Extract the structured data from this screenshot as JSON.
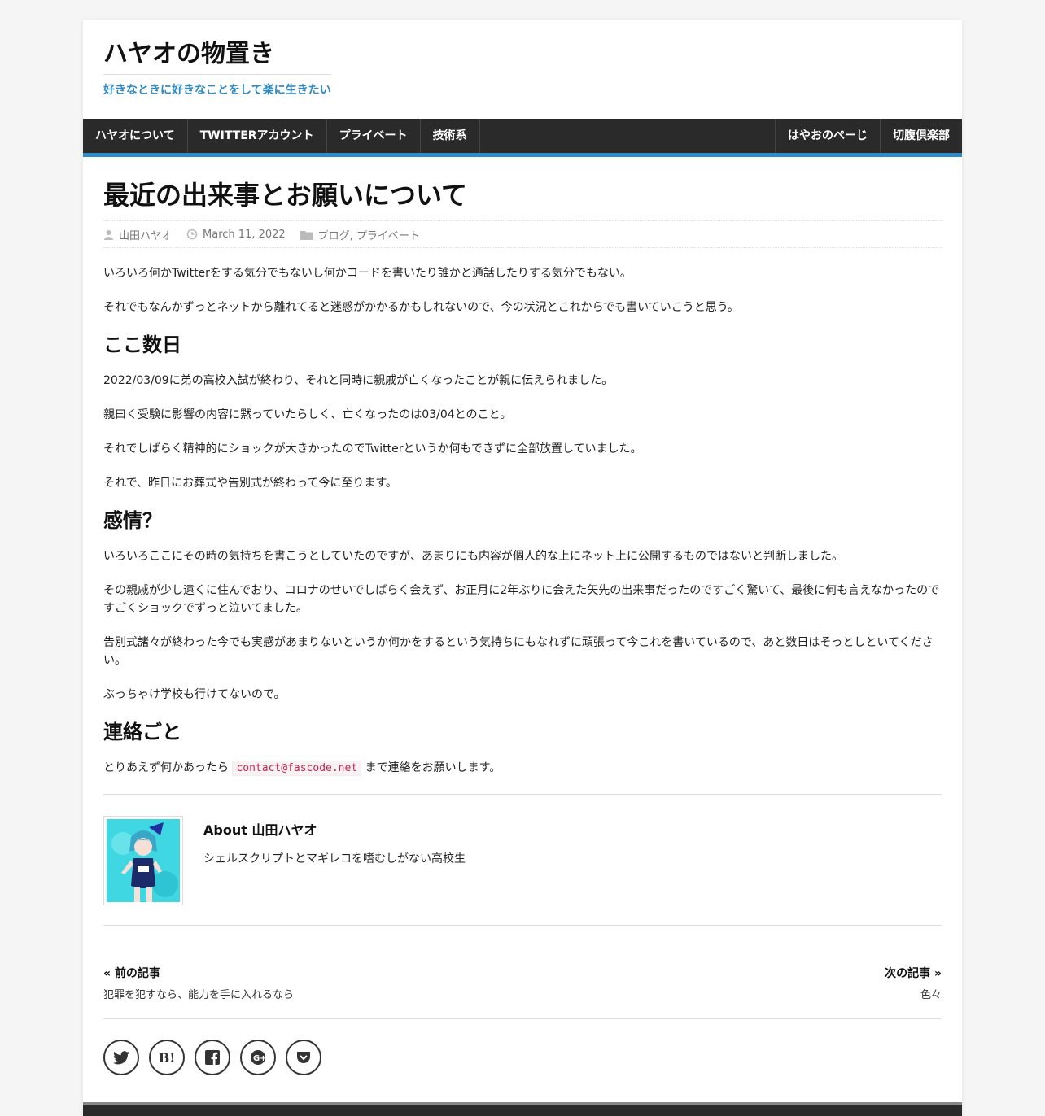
{
  "site": {
    "title": "ハヤオの物置き",
    "description": "好きなときに好きなことをして楽に生きたい"
  },
  "nav": {
    "left": [
      "ハヤオについて",
      "TWITTERアカウント",
      "プライベート",
      "技術系"
    ],
    "right": [
      "はやおのぺーじ",
      "切腹倶楽部"
    ]
  },
  "post": {
    "title": "最近の出来事とお願いについて",
    "author": "山田ハヤオ",
    "date": "March 11, 2022",
    "categories": "ブログ, プライベート",
    "intro": [
      "いろいろ何かTwitterをする気分でもないし何かコードを書いたり誰かと通話したりする気分でもない。",
      "それでもなんかずっとネットから離れてると迷惑がかかるかもしれないので、今の状況とこれからでも書いていこうと思う。"
    ],
    "section1": {
      "heading": "ここ数日",
      "paragraphs": [
        "2022/03/09に弟の高校入試が終わり、それと同時に親戚が亡くなったことが親に伝えられました。",
        "親曰く受験に影響の内容に黙っていたらしく、亡くなったのは03/04とのこと。",
        "それでしばらく精神的にショックが大きかったのでTwitterというか何もできずに全部放置していました。",
        "それで、昨日にお葬式や告別式が終わって今に至ります。"
      ]
    },
    "section2": {
      "heading": "感情？",
      "paragraphs": [
        "いろいろここにその時の気持ちを書こうとしていたのですが、あまりにも内容が個人的な上にネット上に公開するものではないと判断しました。",
        "その親戚が少し遠くに住んでおり、コロナのせいでしばらく会えず、お正月に2年ぶりに会えた矢先の出来事だったのですごく驚いて、最後に何も言えなかったのですごくショックでずっと泣いてました。",
        "告別式諸々が終わった今でも実感があまりないというか何かをするという気持ちにもなれずに頑張って今これを書いているので、あと数日はそっとしといてください。",
        "ぶっちゃけ学校も行けてないので。"
      ]
    },
    "section3": {
      "heading": "連絡ごと",
      "before": "とりあえず何かあったら",
      "code": "contact@fascode.net",
      "after": "まで連絡をお願いします。"
    }
  },
  "author_box": {
    "name": "About 山田ハヤオ",
    "bio": "シェルスクリプトとマギレコを嗜むしがない高校生"
  },
  "post_nav": {
    "prev_label": "« 前の記事",
    "prev_title": "犯罪を犯すなら、能力を手に入れるなら",
    "next_label": "次の記事 »",
    "next_title": "色々"
  },
  "share": {
    "buttons": [
      "twitter-icon",
      "hatena-bookmark-icon",
      "facebook-icon",
      "google-plus-icon",
      "pocket-icon"
    ],
    "hatena_text": "B!"
  },
  "colors": {
    "accent": "#2e8bc7",
    "nav_bg": "#2a2a2a",
    "code_text": "#c7254e"
  }
}
